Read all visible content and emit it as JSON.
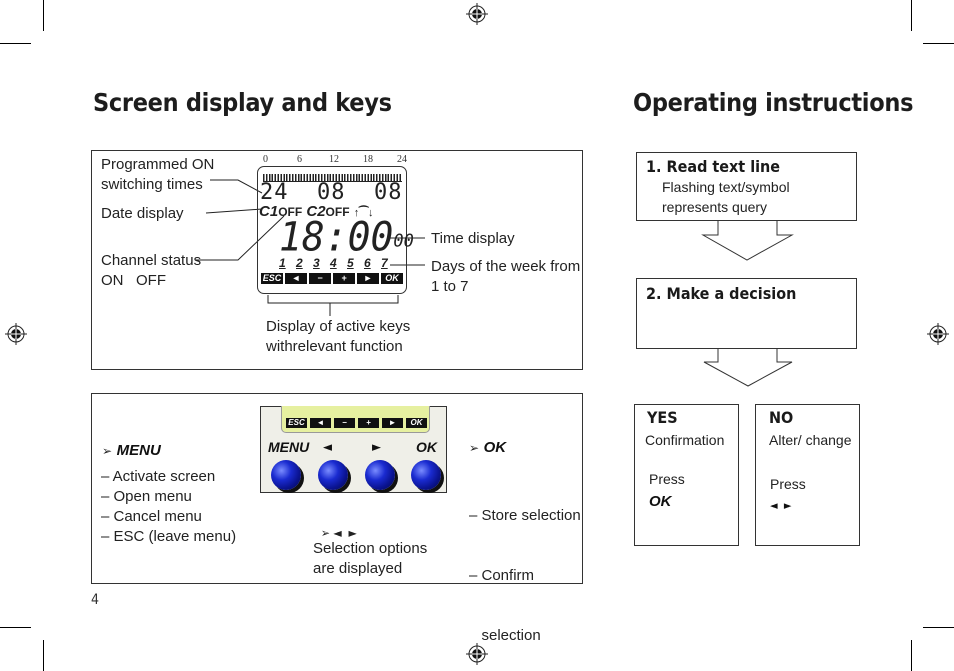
{
  "page": {
    "page_number": "4",
    "left_title": "Screen display and keys",
    "right_title": "Operating instructions"
  },
  "screen_panel": {
    "labels": {
      "programmed_on": [
        "Programmed ON",
        "switching times"
      ],
      "date_display": "Date display",
      "channel_status": [
        "Channel status",
        "ON   OFF"
      ],
      "time_display": "Time display",
      "days_of_week": [
        "Days of the week from",
        "1 to 7"
      ],
      "active_keys": [
        "Display of active keys",
        "withrelevant function"
      ]
    },
    "lcd": {
      "scale_ticks": [
        "0",
        "6",
        "12",
        "18",
        "24"
      ],
      "date_digits": [
        "24",
        "08",
        "08"
      ],
      "channel1": "C1",
      "channel1_state": "OFF",
      "channel2": "C2",
      "channel2_state": "OFF",
      "symbols": "↑⁀↓",
      "time": "18:00",
      "seconds": "00",
      "days": [
        "1",
        "2",
        "3",
        "4",
        "5",
        "6",
        "7"
      ],
      "keys": [
        "ESC",
        "◄",
        "−",
        "+",
        "►",
        "OK"
      ]
    }
  },
  "keys_panel": {
    "menu_heading": "MENU",
    "menu_items": [
      "– Activate screen",
      "– Open menu",
      "– Cancel menu",
      "– ESC (leave menu)"
    ],
    "ok_heading": "OK",
    "ok_items": [
      "– Store selection",
      "– Confirm",
      "   selection"
    ],
    "arrows_label": "◄  ►",
    "arrows_desc": [
      "Selection options",
      "are displayed"
    ],
    "device": {
      "keys": [
        "ESC",
        "◄",
        "−",
        "+",
        "►",
        "OK"
      ],
      "button_labels": [
        "MENU",
        "◄",
        "►",
        "OK"
      ]
    },
    "bullet": "➢"
  },
  "instructions": {
    "step1": {
      "number": "1.",
      "title": "Read text line",
      "lines": [
        "Flashing text/symbol",
        "represents query"
      ]
    },
    "step2": {
      "number": "2.",
      "title": "Make a decision"
    },
    "yes": {
      "title": "YES",
      "desc": "Confirmation",
      "press": "Press",
      "key": "OK"
    },
    "no": {
      "title": "NO",
      "desc": "Alter/ change",
      "press": "Press",
      "key": "◄  ►"
    }
  },
  "colors": {
    "lcd_green": "#e6f0a0",
    "device_bg": "#efefe8",
    "knob_blue": "#1a2bd0"
  }
}
